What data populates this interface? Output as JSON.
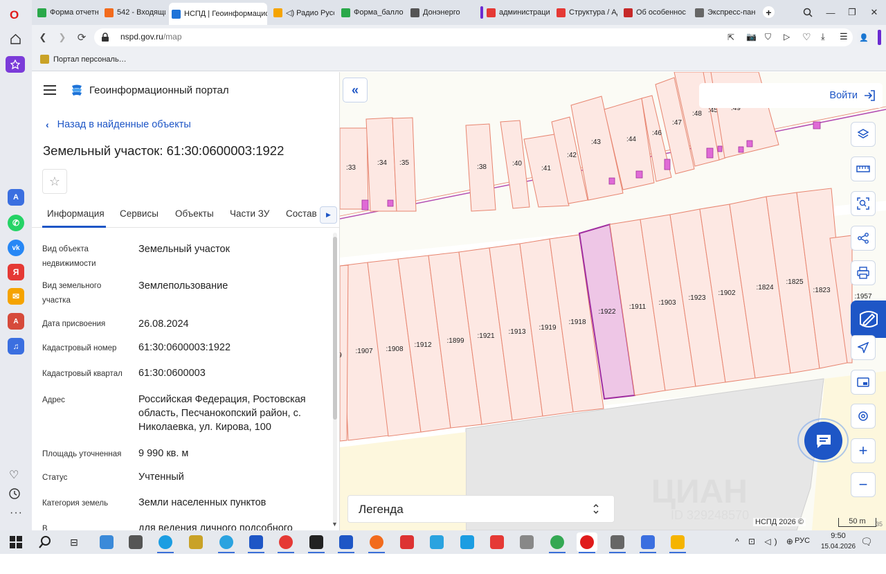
{
  "browser": {
    "tabs": [
      {
        "label": "Форма отчетн",
        "color": "#2aa84a"
      },
      {
        "label": "542 - Входящи",
        "color": "#f26b1d"
      },
      {
        "label": "НСПД | Геоинформацис",
        "color": "#1e73d8",
        "active": true
      },
      {
        "label": "◁) Радио Русс",
        "color": "#f5a400"
      },
      {
        "label": "Форма_балло",
        "color": "#2aa84a"
      },
      {
        "label": "Донэнерго",
        "color": "#555555"
      },
      {
        "label": "администраци",
        "color": "#e53935"
      },
      {
        "label": "Структура / Ад",
        "color": "#e53935"
      },
      {
        "label": "Об особеннос",
        "color": "#c62828"
      },
      {
        "label": "Экспресс-пане",
        "color": "#666666"
      }
    ],
    "url_domain": "nspd.gov.ru",
    "url_path": "/map",
    "bookmark": "Портал персональ…",
    "new_tab_icon": "plus-icon"
  },
  "panel": {
    "app_title": "Геоинформационный портал",
    "back_link": "Назад в найденные объекты",
    "object_title": "Земельный участок: 61:30:0600003:1922",
    "tabs": [
      "Информация",
      "Сервисы",
      "Объекты",
      "Части ЗУ",
      "Состав"
    ],
    "attributes": [
      {
        "key": "Вид объекта недвижимости",
        "value": "Земельный участок"
      },
      {
        "key": "Вид земельного участка",
        "value": "Землепользование"
      },
      {
        "key": "Дата присвоения",
        "value": "26.08.2024"
      },
      {
        "key": "Кадастровый номер",
        "value": "61:30:0600003:1922"
      },
      {
        "key": "Кадастровый квартал",
        "value": "61:30:0600003"
      },
      {
        "key": "Адрес",
        "value": "Российская Федерация, Ростовская область, Песчанокопский район, с. Николаевка, ул. Кирова, 100"
      },
      {
        "key": "Площадь уточненная",
        "value": "9 990 кв. м"
      },
      {
        "key": "Статус",
        "value": "Учтенный"
      },
      {
        "key": "Категория земель",
        "value": "Земли населенных пунктов"
      },
      {
        "key": "В",
        "value": "для ведения личного подсобного"
      }
    ]
  },
  "map": {
    "login": "Войти",
    "legend": "Легенда",
    "copyright": "НСПД 2026 ©",
    "scale": "50 m",
    "scale_suffix": "35",
    "upper_parcels": [
      ":33",
      ":34",
      ":35",
      ":38",
      ":40",
      ":41",
      ":42",
      ":43",
      ":44",
      ":46",
      ":47",
      ":48",
      ":45",
      ":49"
    ],
    "lower_parcels": [
      ":1907",
      ":1908",
      ":1912",
      ":1899",
      ":1921",
      ":1913",
      ":1919",
      ":1918",
      ":1922",
      ":1911",
      ":1903",
      ":1923",
      ":1902",
      ":1824",
      ":1825",
      ":1823",
      ":1957",
      "9"
    ],
    "selected_parcel": ":1922",
    "colors": {
      "parcel_fill": "#fde8e3",
      "parcel_stroke": "#e7846f",
      "selected_fill": "#eec6e6",
      "selected_stroke": "#a02ea0",
      "accent": "#1e56c6"
    },
    "watermark": "ЦИАН",
    "watermark_id": "ID 329248570"
  },
  "taskbar": {
    "time": "9:50",
    "date": "15.04.2026",
    "lang": "РУС"
  }
}
